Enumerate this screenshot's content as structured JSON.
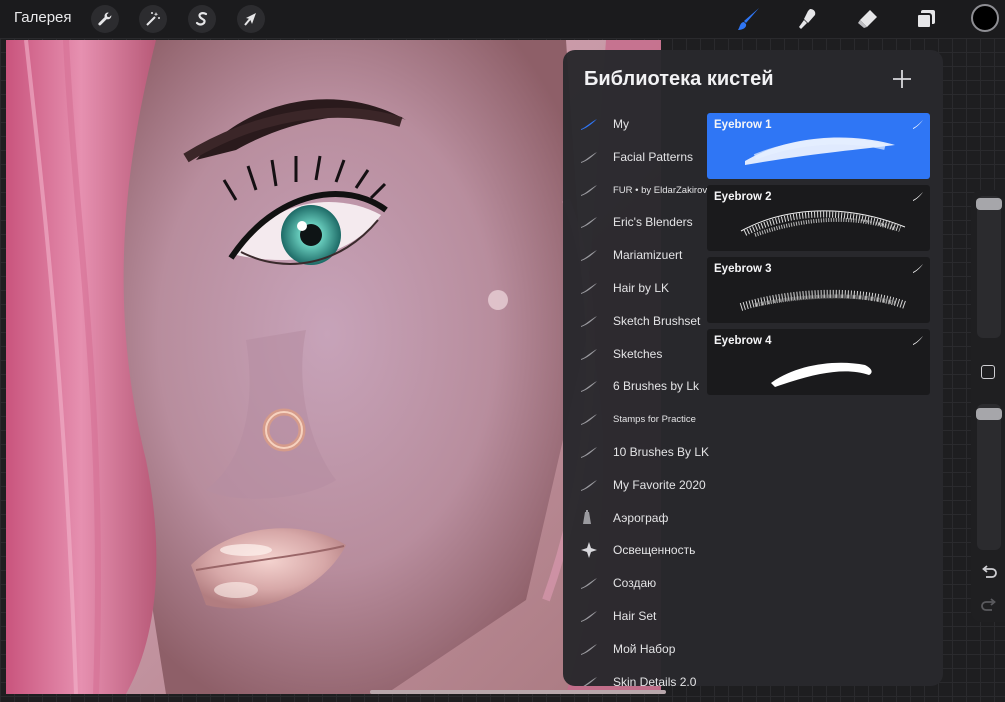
{
  "toolbar": {
    "gallery_label": "Галерея",
    "left_tools": [
      {
        "name": "actions",
        "icon": "wrench-icon"
      },
      {
        "name": "adjustments",
        "icon": "magic-wand-icon"
      },
      {
        "name": "selection",
        "icon": "selection-s-icon"
      },
      {
        "name": "transform",
        "icon": "arrow-cursor-icon"
      }
    ],
    "right_tools": [
      {
        "name": "brush",
        "icon": "brush-icon",
        "active": true
      },
      {
        "name": "smudge",
        "icon": "smudge-icon",
        "active": false
      },
      {
        "name": "eraser",
        "icon": "eraser-icon",
        "active": false
      },
      {
        "name": "layers",
        "icon": "layers-icon",
        "active": false
      }
    ],
    "current_color": "#000000",
    "accent_color": "#2f76f5"
  },
  "brush_library": {
    "title": "Библиотека кистей",
    "add_icon": "plus-icon",
    "sets": [
      {
        "label": "My",
        "icon": "brush-stroke-icon",
        "active": true
      },
      {
        "label": "Facial Patterns",
        "icon": "brush-stroke-icon"
      },
      {
        "label": "FUR • by EldarZakirov",
        "icon": "brush-stroke-icon"
      },
      {
        "label": "Eric's Blenders",
        "icon": "brush-stroke-icon"
      },
      {
        "label": "Mariamizuert",
        "icon": "brush-stroke-icon"
      },
      {
        "label": "Hair by LK",
        "icon": "brush-stroke-icon"
      },
      {
        "label": "Sketch Brushset",
        "icon": "brush-stroke-icon"
      },
      {
        "label": "Sketches",
        "icon": "brush-stroke-icon"
      },
      {
        "label": "6 Brushes by Lk",
        "icon": "brush-stroke-icon"
      },
      {
        "label": "Stamps for Practice",
        "icon": "brush-stroke-icon"
      },
      {
        "label": "10 Brushes By LK",
        "icon": "brush-stroke-icon"
      },
      {
        "label": "My Favorite 2020",
        "icon": "brush-stroke-icon"
      },
      {
        "label": "Аэрограф",
        "icon": "airbrush-icon"
      },
      {
        "label": "Освещенность",
        "icon": "sparkle-icon"
      },
      {
        "label": "Создаю",
        "icon": "brush-stroke-icon"
      },
      {
        "label": "Hair Set",
        "icon": "brush-stroke-icon"
      },
      {
        "label": "Мой Набор",
        "icon": "brush-stroke-icon"
      },
      {
        "label": "Skin Details 2.0",
        "icon": "brush-stroke-icon"
      }
    ],
    "brushes": [
      {
        "name": "Eyebrow 1",
        "selected": true
      },
      {
        "name": "Eyebrow 2",
        "selected": false
      },
      {
        "name": "Eyebrow 3",
        "selected": false
      },
      {
        "name": "Eyebrow 4",
        "selected": false
      }
    ]
  },
  "sidebar": {
    "brush_size_level": 0.05,
    "opacity_level": 0.05,
    "modify_icon": "square-modify-icon",
    "undo_icon": "undo-icon",
    "redo_icon": "redo-icon"
  }
}
